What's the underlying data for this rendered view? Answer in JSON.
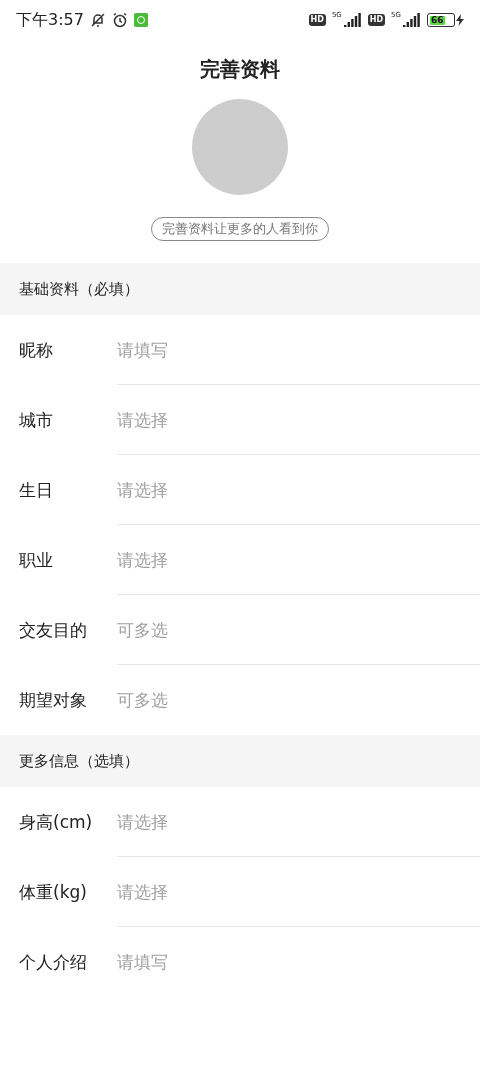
{
  "status_bar": {
    "time": "下午3:57",
    "sims": [
      {
        "hd": "HD",
        "network": "5G"
      },
      {
        "hd": "HD",
        "network": "5G"
      }
    ],
    "battery": "66"
  },
  "title": "完善资料",
  "avatar": {
    "hint": "完善资料让更多的人看到你"
  },
  "sections": [
    {
      "title": "基础资料（必填）",
      "fields": [
        {
          "label": "昵称",
          "placeholder": "请填写"
        },
        {
          "label": "城市",
          "placeholder": "请选择"
        },
        {
          "label": "生日",
          "placeholder": "请选择"
        },
        {
          "label": "职业",
          "placeholder": "请选择"
        },
        {
          "label": "交友目的",
          "placeholder": "可多选"
        },
        {
          "label": "期望对象",
          "placeholder": "可多选"
        }
      ]
    },
    {
      "title": "更多信息（选填）",
      "fields": [
        {
          "label": "身高(cm)",
          "placeholder": "请选择"
        },
        {
          "label": "体重(kg)",
          "placeholder": "请选择"
        },
        {
          "label": "个人介绍",
          "placeholder": "请填写"
        }
      ]
    }
  ]
}
